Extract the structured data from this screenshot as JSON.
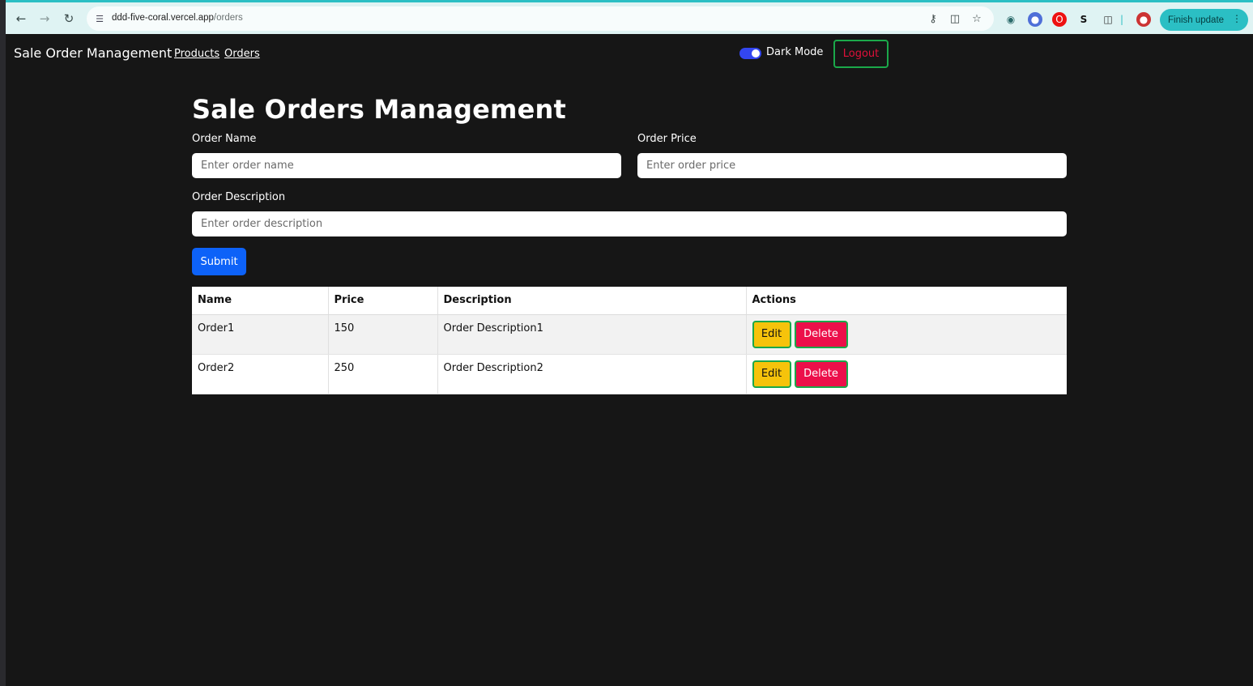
{
  "browser": {
    "url_host": "ddd-five-coral.vercel.app",
    "url_path": "/orders",
    "update_button": "Finish update",
    "extension_letter": "S"
  },
  "navbar": {
    "brand": "Sale Order Management",
    "links": [
      "Products",
      "Orders"
    ],
    "dark_mode_label": "Dark Mode",
    "dark_mode_on": true,
    "logout_label": "Logout"
  },
  "page": {
    "title": "Sale Orders Management",
    "form": {
      "name_label": "Order Name",
      "name_placeholder": "Enter order name",
      "price_label": "Order Price",
      "price_placeholder": "Enter order price",
      "description_label": "Order Description",
      "description_placeholder": "Enter order description",
      "submit_label": "Submit"
    },
    "table": {
      "headers": [
        "Name",
        "Price",
        "Description",
        "Actions"
      ],
      "rows": [
        {
          "name": "Order1",
          "price": "150",
          "description": "Order Description1"
        },
        {
          "name": "Order2",
          "price": "250",
          "description": "Order Description2"
        }
      ],
      "edit_label": "Edit",
      "delete_label": "Delete"
    }
  },
  "colors": {
    "background": "#161616",
    "primary": "#0d62f8",
    "edit": "#f6c30b",
    "delete": "#ec0f4a",
    "logout_border": "#1ba84a",
    "toggle": "#3346f0",
    "chrome_accent": "#2bbfc4"
  }
}
